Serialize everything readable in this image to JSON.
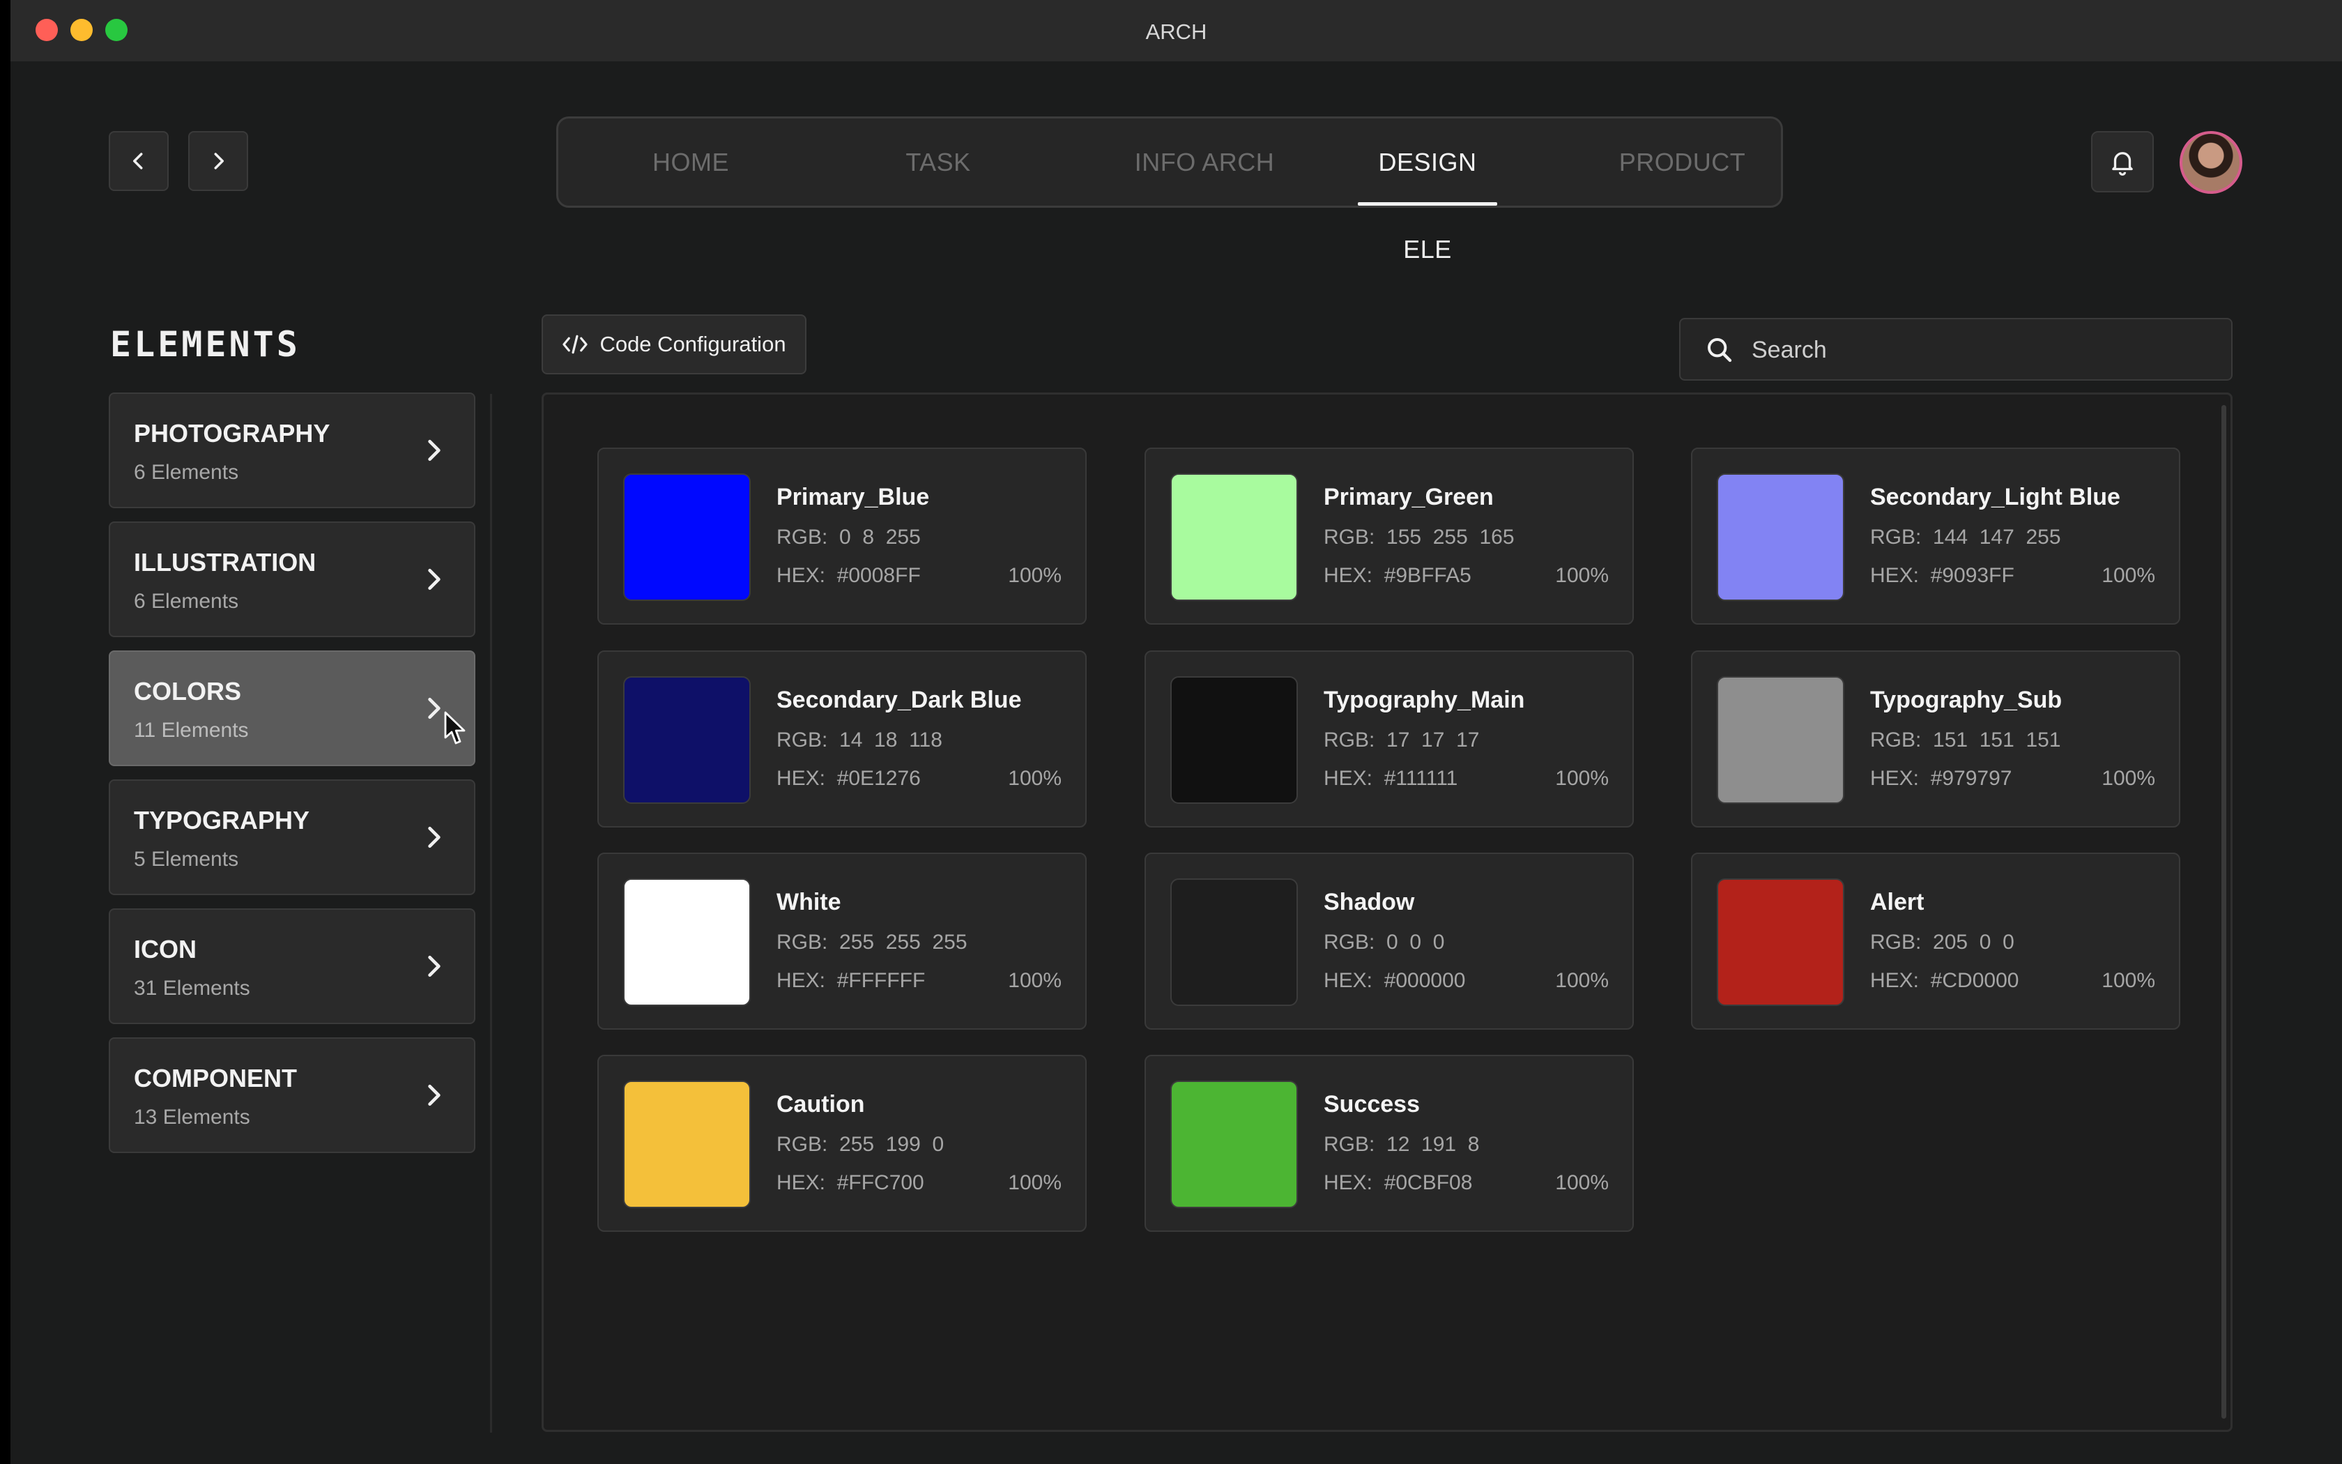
{
  "window": {
    "title": "ARCH"
  },
  "nav": {
    "tabs": [
      {
        "label": "HOME",
        "active": false
      },
      {
        "label": "TASK",
        "active": false
      },
      {
        "label": "INFO ARCH",
        "active": false
      },
      {
        "label": "DESIGN ELE",
        "active": true
      },
      {
        "label": "PRODUCT",
        "active": false
      }
    ]
  },
  "sidebar": {
    "title": "ELEMENTS",
    "categories": [
      {
        "name": "PHOTOGRAPHY",
        "count": "6 Elements"
      },
      {
        "name": "ILLUSTRATION",
        "count": "6 Elements"
      },
      {
        "name": "COLORS",
        "count": "11 Elements",
        "active": true
      },
      {
        "name": "TYPOGRAPHY",
        "count": "5 Elements"
      },
      {
        "name": "ICON",
        "count": "31 Elements"
      },
      {
        "name": "COMPONENT",
        "count": "13 Elements"
      }
    ]
  },
  "toolbar": {
    "code_config_label": "Code Configuration"
  },
  "search": {
    "placeholder": "Search"
  },
  "colors": [
    {
      "name": "Primary_Blue",
      "rgb": "RGB:  0  8  255",
      "hex": "HEX:  #0008FF",
      "opacity": "100%",
      "swatch": "#0008FF"
    },
    {
      "name": "Primary_Green",
      "rgb": "RGB:  155  255  165",
      "hex": "HEX:  #9BFFA5",
      "opacity": "100%",
      "swatch": "#A8FB9E"
    },
    {
      "name": "Secondary_Light Blue",
      "rgb": "RGB:  144  147  255",
      "hex": "HEX:  #9093FF",
      "opacity": "100%",
      "swatch": "#8283F3"
    },
    {
      "name": "Secondary_Dark Blue",
      "rgb": "RGB:  14  18  118",
      "hex": "HEX:  #0E1276",
      "opacity": "100%",
      "swatch": "#0E1068"
    },
    {
      "name": "Typography_Main",
      "rgb": "RGB:  17  17  17",
      "hex": "HEX:  #111111",
      "opacity": "100%",
      "swatch": "#111111"
    },
    {
      "name": "Typography_Sub",
      "rgb": "RGB:  151  151  151",
      "hex": "HEX:  #979797",
      "opacity": "100%",
      "swatch": "#8E8E8E"
    },
    {
      "name": "White",
      "rgb": "RGB:  255  255  255",
      "hex": "HEX:  #FFFFFF",
      "opacity": "100%",
      "swatch": "#FFFFFF"
    },
    {
      "name": "Shadow",
      "rgb": "RGB:  0  0  0",
      "hex": "HEX:  #000000",
      "opacity": "100%",
      "swatch": "#1E1E1E"
    },
    {
      "name": "Alert",
      "rgb": "RGB:  205  0  0",
      "hex": "HEX:  #CD0000",
      "opacity": "100%",
      "swatch": "#B3221A"
    },
    {
      "name": "Caution",
      "rgb": "RGB:  255  199  0",
      "hex": "HEX:  #FFC700",
      "opacity": "100%",
      "swatch": "#F4C03A"
    },
    {
      "name": "Success",
      "rgb": "RGB:  12  191  8",
      "hex": "HEX:  #0CBF08",
      "opacity": "100%",
      "swatch": "#4CB533"
    }
  ]
}
